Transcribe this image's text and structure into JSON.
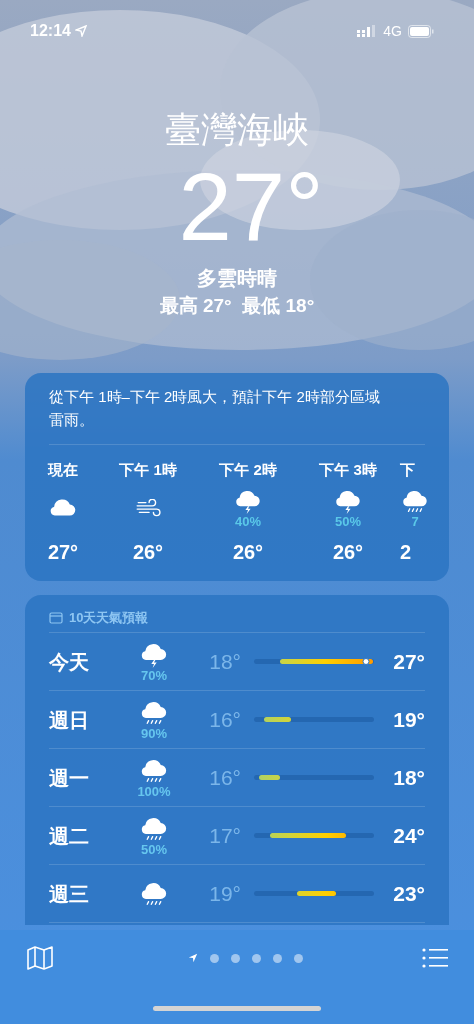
{
  "status_bar": {
    "time": "12:14",
    "network": "4G"
  },
  "header": {
    "location": "臺灣海峽",
    "temperature": "27°",
    "condition": "多雲時晴",
    "high_low": "最高 27°  最低 18°"
  },
  "hourly": {
    "summary": "從下午 1時–下午 2時風大，預計下午 2時部分區域雷雨。",
    "hours": [
      {
        "label": "現在",
        "kind": "cloud",
        "temp": "27°"
      },
      {
        "label": "下午 1時",
        "kind": "wind",
        "temp": "26°"
      },
      {
        "label": "下午 2時",
        "kind": "thunder",
        "precip": "40%",
        "temp": "26°"
      },
      {
        "label": "下午 3時",
        "kind": "thunder",
        "precip": "50%",
        "temp": "26°"
      },
      {
        "label": "下",
        "kind": "rain",
        "precip": "7",
        "temp": "2"
      }
    ]
  },
  "daily": {
    "title": "10天天氣預報",
    "days": [
      {
        "day": "今天",
        "kind": "thunder",
        "precip": "70%",
        "low": "18°",
        "high": "27°",
        "current": {
          "level": 0.93
        }
      },
      {
        "day": "週日",
        "kind": "rain",
        "precip": "90%",
        "low": "16°",
        "high": "19°"
      },
      {
        "day": "週一",
        "kind": "rain",
        "precip": "100%",
        "low": "16°",
        "high": "18°"
      },
      {
        "day": "週二",
        "kind": "rain",
        "precip": "50%",
        "low": "17°",
        "high": "24°"
      },
      {
        "day": "週三",
        "kind": "rain",
        "low": "19°",
        "high": "23°"
      }
    ]
  },
  "toolbar": {
    "pages": [
      {
        "kind": "location",
        "selected": true
      },
      {
        "kind": "dot",
        "selected": false
      },
      {
        "kind": "dot",
        "selected": false
      },
      {
        "kind": "dot",
        "selected": false
      },
      {
        "kind": "dot",
        "selected": false
      },
      {
        "kind": "dot",
        "selected": false
      }
    ]
  }
}
